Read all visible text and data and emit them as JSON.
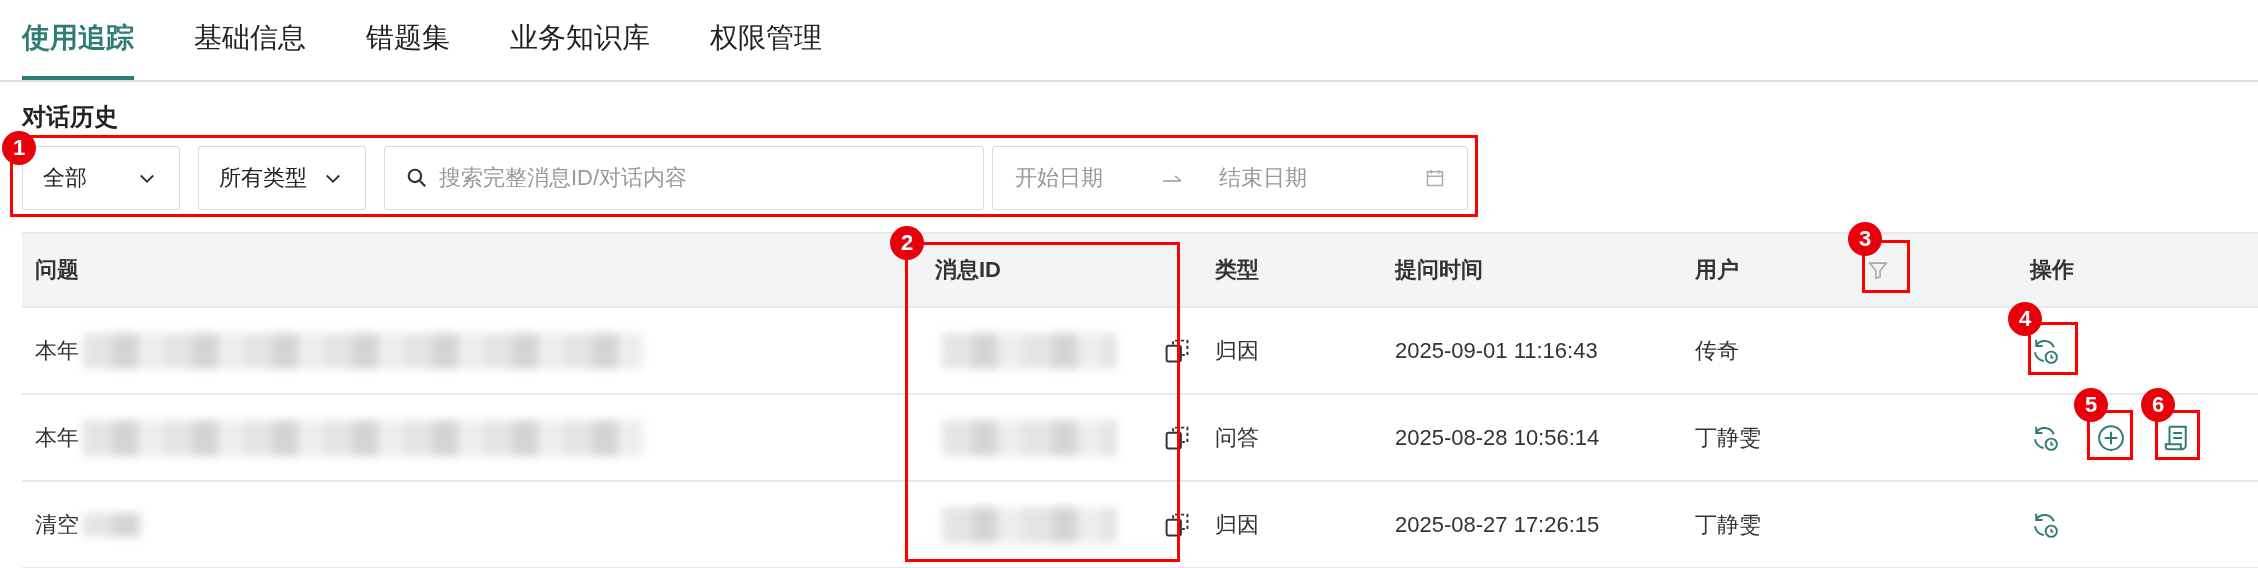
{
  "tabs": [
    {
      "label": "使用追踪",
      "selected": true
    },
    {
      "label": "基础信息",
      "selected": false
    },
    {
      "label": "错题集",
      "selected": false
    },
    {
      "label": "业务知识库",
      "selected": false
    },
    {
      "label": "权限管理",
      "selected": false
    }
  ],
  "section_title": "对话历史",
  "filters": {
    "scope": "全部",
    "type": "所有类型",
    "search": {
      "placeholder": "搜索完整消息ID/对话内容"
    },
    "date_range": {
      "start_placeholder": "开始日期",
      "end_placeholder": "结束日期"
    }
  },
  "table": {
    "columns": [
      {
        "label": "问题",
        "filter": false
      },
      {
        "label": "消息ID",
        "filter": false
      },
      {
        "label": "类型",
        "filter": false
      },
      {
        "label": "提问时间",
        "filter": false
      },
      {
        "label": "用户",
        "filter": true
      },
      {
        "label": "操作",
        "filter": false
      }
    ],
    "rows": [
      {
        "question": "本年",
        "type": "归因",
        "time": "2025-09-01 11:16:43",
        "user": "传奇",
        "actions": [
          {
            "kind": "history"
          }
        ]
      },
      {
        "question": "本年",
        "type": "问答",
        "time": "2025-08-28 10:56:14",
        "user": "丁静雯",
        "actions": [
          {
            "kind": "history"
          },
          {
            "kind": "add"
          },
          {
            "kind": "log"
          }
        ]
      },
      {
        "question": "清空",
        "type": "归因",
        "time": "2025-08-27 17:26:15",
        "user": "丁静雯",
        "actions": [
          {
            "kind": "history"
          }
        ]
      }
    ]
  },
  "callouts": [
    {
      "number": "1"
    },
    {
      "number": "2"
    },
    {
      "number": "3"
    },
    {
      "number": "4"
    },
    {
      "number": "5"
    },
    {
      "number": "6"
    }
  ]
}
